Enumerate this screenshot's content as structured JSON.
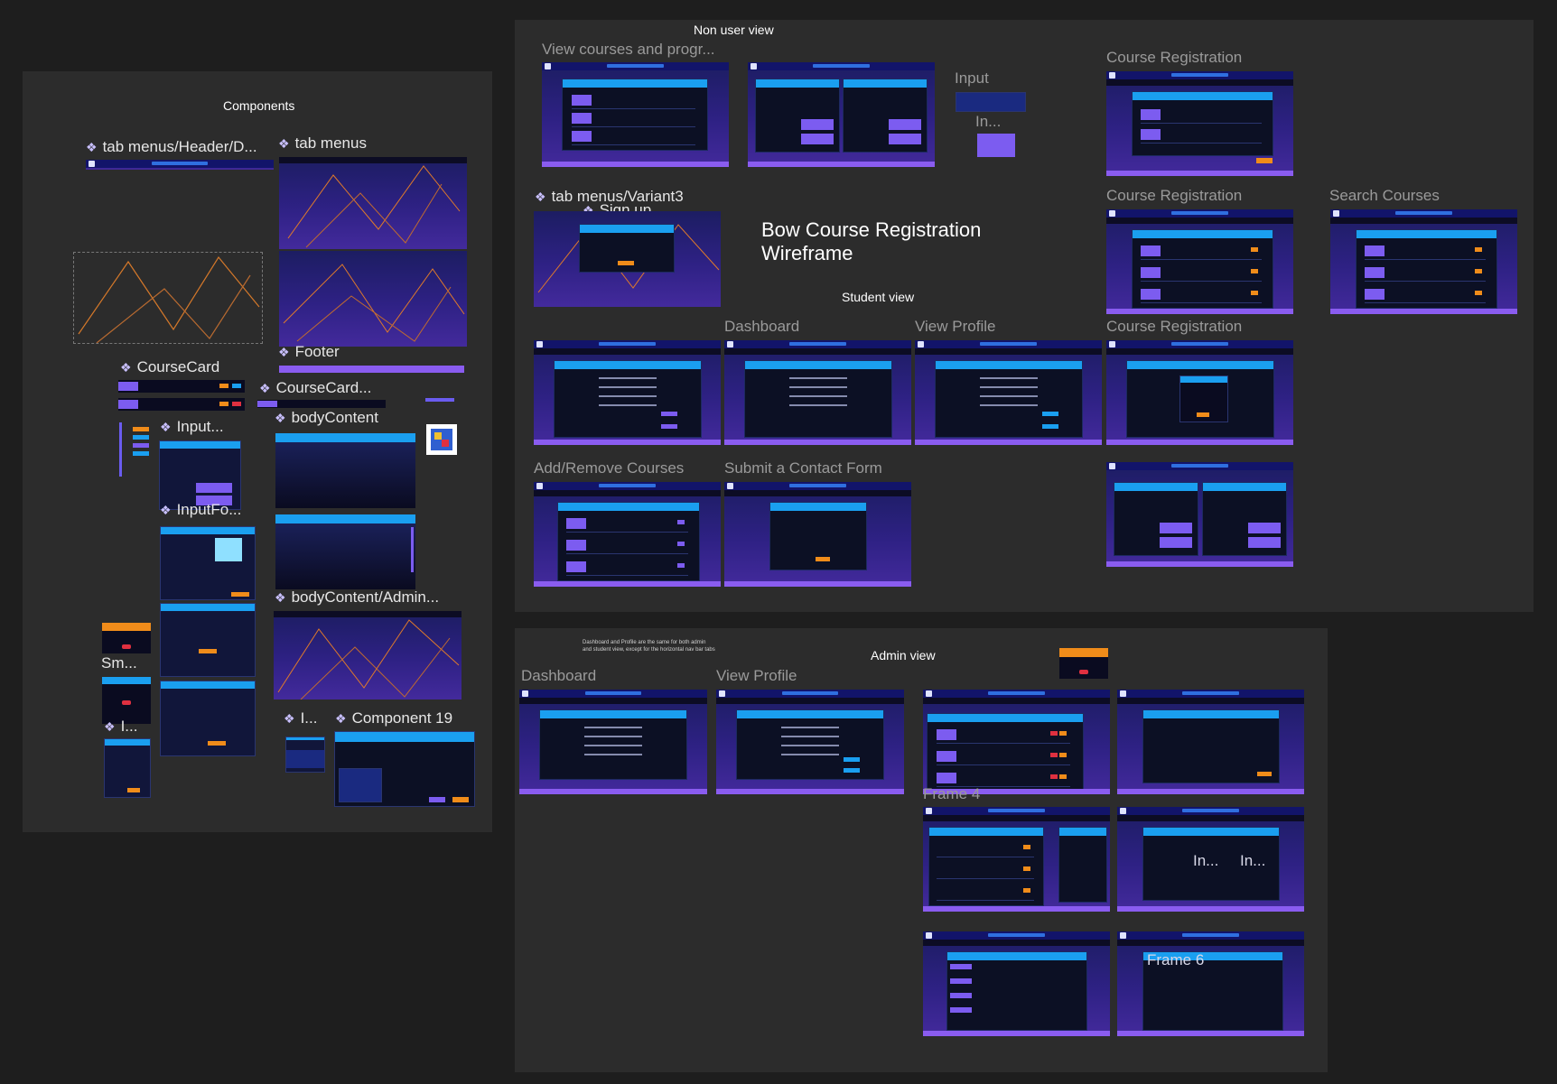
{
  "canvas": {
    "background": "#1e1e1e",
    "panel": "#2c2c2c",
    "accent_blue": "#1a9ff0",
    "accent_orange": "#f08c1a",
    "accent_purple": "#7c5cf0"
  },
  "components": {
    "title": "Components",
    "labels": {
      "tab_header": "tab menus/Header/D...",
      "tab_menus": "tab menus",
      "footer": "Footer",
      "course_card": "CourseCard",
      "course_card2": "CourseCard...",
      "input": "Input...",
      "body_content": "bodyContent",
      "input_form": "InputFo...",
      "sm": "Sm...",
      "body_content_admin": "bodyContent/Admin...",
      "i": "I...",
      "i2": "I...",
      "component19": "Component 19"
    }
  },
  "non_user": {
    "title": "Non user view",
    "view_courses": "View courses and progr...",
    "input_label": "Input",
    "in_label": "In...",
    "course_registration_1": "Course Registration",
    "course_registration_2": "Course Registration",
    "search_courses": "Search Courses",
    "tab_variant": "tab menus/Variant3",
    "sign_up": "Sign up...",
    "wireframe_title": "Bow Course Registration\nWireframe",
    "student_view": "Student view",
    "dashboard": "Dashboard",
    "view_profile": "View Profile",
    "course_registration_3": "Course Registration",
    "add_remove": "Add/Remove Courses",
    "contact_form": "Submit a Contact Form"
  },
  "admin": {
    "title": "Admin view",
    "note": "Dashboard and Profile are the same for both admin and student view, except for the horizontal nav bar tabs",
    "dashboard": "Dashboard",
    "view_profile": "View Profile",
    "frame4": "Frame 4",
    "frame6": "Frame 6",
    "in1": "In...",
    "in2": "In..."
  }
}
